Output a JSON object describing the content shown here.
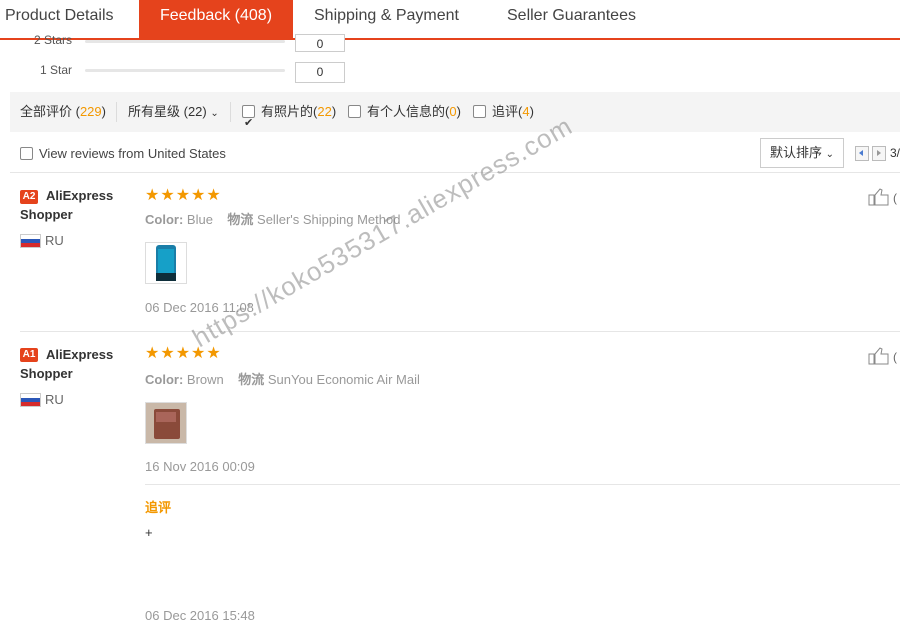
{
  "tabs": [
    {
      "label": "Product Details"
    },
    {
      "label": "Feedback (408)"
    },
    {
      "label": "Shipping & Payment"
    },
    {
      "label": "Seller Guarantees"
    }
  ],
  "histogram": [
    {
      "label": "2 Stars",
      "count": "0"
    },
    {
      "label": "1 Star",
      "count": "0"
    }
  ],
  "filters": {
    "all_label": "全部评价 (",
    "all_count": "229",
    "all_close": ")",
    "star_select": "所有星级 (22)",
    "photo_label": "有照片的(",
    "photo_count": "22",
    "photo_close": ")",
    "personal_label": "有个人信息的(",
    "personal_count": "0",
    "personal_close": ")",
    "additional_label": "追评(",
    "additional_count": "4",
    "additional_close": ")"
  },
  "view_reviews_label": "View reviews from United States",
  "sort_label": "默认排序",
  "pagination_text": "3/",
  "reviews": [
    {
      "badge": "A2",
      "user": "AliExpress Shopper",
      "country": "RU",
      "stars": "★★★★★",
      "color_label": "Color:",
      "color_value": "Blue",
      "shipping_label": "物流",
      "shipping_value": "Seller's Shipping Method",
      "date": "06 Dec 2016 11:08",
      "like_count": "("
    },
    {
      "badge": "A1",
      "user": "AliExpress Shopper",
      "country": "RU",
      "stars": "★★★★★",
      "color_label": "Color:",
      "color_value": "Brown",
      "shipping_label": "物流",
      "shipping_value": "SunYou Economic Air Mail",
      "date": "16 Nov 2016 00:09",
      "like_count": "(",
      "additional_label": "追评",
      "additional_text": "+",
      "additional_date": "06 Dec 2016 15:48"
    }
  ],
  "watermark": "https://koko535317.aliexpress.com",
  "colors": {
    "accent": "#e5431c",
    "star": "#f39800"
  }
}
